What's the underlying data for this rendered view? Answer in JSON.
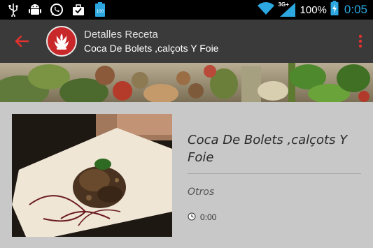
{
  "status_bar": {
    "network_label": "3G+",
    "battery": "100%",
    "time": "0:05",
    "accent": "#2ca7e0",
    "icons": [
      "usb-icon",
      "android-icon",
      "whatsapp-icon",
      "briefcase-icon",
      "battery-100-icon"
    ]
  },
  "app_bar": {
    "title": "Detalles Receta",
    "subtitle": "Coca De Bolets ,calçots Y Foie",
    "background": "#3a3a3a",
    "accent": "#e0322f"
  },
  "recipe": {
    "title": "Coca De Bolets ,calçots Y Foie",
    "category": "Otros",
    "time": "0:00"
  }
}
